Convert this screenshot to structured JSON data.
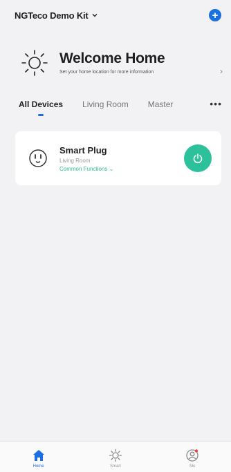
{
  "header": {
    "home_name": "NGTeco Demo Kit",
    "add_icon": "plus-icon"
  },
  "welcome": {
    "title": "Welcome Home",
    "subtitle": "Set your home location for more information",
    "icon": "sun-icon"
  },
  "tabs": [
    {
      "label": "All Devices",
      "active": true
    },
    {
      "label": "Living Room",
      "active": false
    },
    {
      "label": "Master",
      "active": false
    }
  ],
  "more_icon": "more-icon",
  "device": {
    "name": "Smart Plug",
    "room": "Living Room",
    "functions_label": "Common Functions",
    "status_color": "#2cc19a"
  },
  "nav": [
    {
      "label": "Home",
      "icon": "home-icon",
      "active": true
    },
    {
      "label": "Smart",
      "icon": "smart-icon",
      "active": false
    },
    {
      "label": "Me",
      "icon": "profile-icon",
      "active": false
    }
  ],
  "colors": {
    "accent": "#1b6fe0",
    "device_on": "#2cc19a"
  }
}
